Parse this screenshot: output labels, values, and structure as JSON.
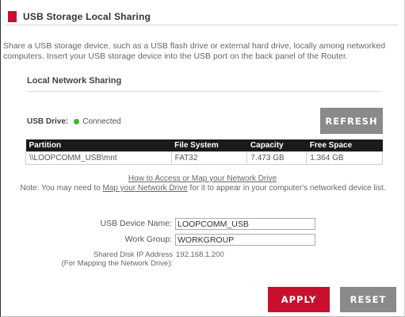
{
  "header": {
    "title": "USB Storage Local Sharing"
  },
  "intro": "Share a USB storage device, such as a USB flash drive or external hard drive, locally among networked computers. Insert your USB storage device into the USB port on the back panel of the Router.",
  "local_sharing": {
    "title": "Local Network Sharing",
    "usb_drive_label": "USB Drive:",
    "usb_status": "Connected",
    "refresh_label": "REFRESH"
  },
  "table": {
    "headers": [
      "Partition",
      "File System",
      "Capacity",
      "Free Space"
    ],
    "rows": [
      [
        "\\\\LOOPCOMM_USB\\mnt",
        "FAT32",
        "7.473 GB",
        "1.364 GB"
      ]
    ]
  },
  "links": {
    "access_link": "How to Access or Map your Network Drive",
    "note_prefix": "Note: You may need to ",
    "note_link": "Map your Network Drive",
    "note_suffix": " for it to appear in your computer's networked device list."
  },
  "form": {
    "device_name_label": "USB Device Name:",
    "device_name_value": "LOOPCOMM_USB",
    "work_group_label": "Work Group:",
    "work_group_value": "WORKGROUP",
    "ip_label_line1": "Shared Disk IP Address",
    "ip_label_line2": "(For Mapping the Network Drive):",
    "ip_value": "192.168.1.200"
  },
  "actions": {
    "apply_label": "APPLY",
    "reset_label": "RESET"
  },
  "colors": {
    "accent": "#c8102e",
    "status_connected": "#3cb521",
    "button_gray": "#8a8a8a",
    "table_header": "#1a1a1a"
  }
}
